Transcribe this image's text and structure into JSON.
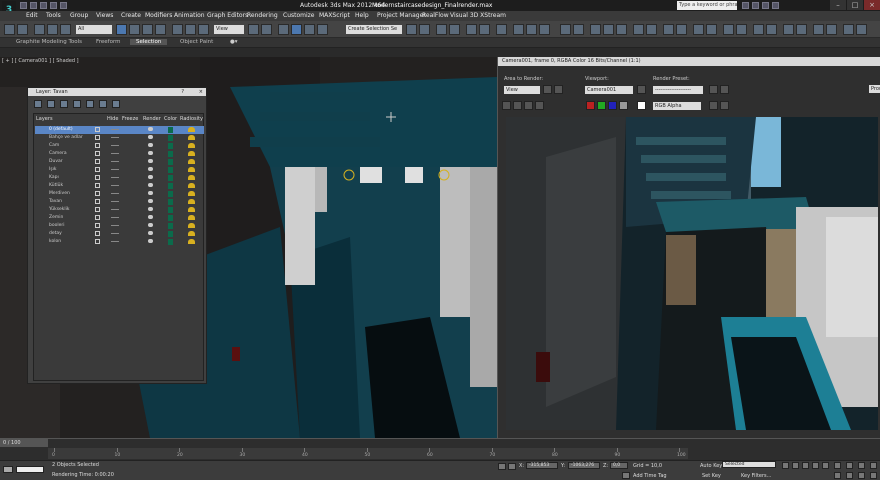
{
  "titlebar": {
    "app_title": "Autodesk 3ds Max  2012 x64",
    "file_name": "Modernstaircasedesign_Finalrender.max",
    "search_placeholder": "Type a keyword or phrase"
  },
  "menu": [
    "Edit",
    "Tools",
    "Group",
    "Views",
    "Create",
    "Modifiers",
    "Animation",
    "Graph Editors",
    "Rendering",
    "Customize",
    "MAXScript",
    "Help",
    "Project Manager",
    "RealFlow",
    "Visual 3D XStream"
  ],
  "toolbar": {
    "selection_filter": "All",
    "coordinate": "View",
    "selection_set": "Create Selection Se"
  },
  "ribbon": [
    "Graphite Modeling Tools",
    "Freeform",
    "Selection",
    "Object Paint"
  ],
  "viewport": {
    "label": "[ + ] [ Camera001 ] [ Shaded ]"
  },
  "layer_explorer": {
    "title": "Layer: Tavan",
    "columns": [
      "Layers",
      "Hide",
      "Freeze",
      "Render",
      "Color",
      "Radiosity"
    ],
    "rows": [
      {
        "name": "0 (default)"
      },
      {
        "name": "Bahçe ve adlar"
      },
      {
        "name": "Cam"
      },
      {
        "name": "Camera"
      },
      {
        "name": "Duvar"
      },
      {
        "name": "Işık"
      },
      {
        "name": "Kapı"
      },
      {
        "name": "Kütlük"
      },
      {
        "name": "Merdiven"
      },
      {
        "name": "Tavan"
      },
      {
        "name": "Yükseklik"
      },
      {
        "name": "Zemin"
      },
      {
        "name": "booleri"
      },
      {
        "name": "detay"
      },
      {
        "name": "kolon"
      }
    ]
  },
  "render_window": {
    "title": "Camera001, frame 0, RGBA Color 16 Bits/Channel (1:1)",
    "area_label": "Area to Render:",
    "area_value": "View",
    "viewport_label": "Viewport:",
    "viewport_value": "Camera001",
    "preset_label": "Render Preset:",
    "preset_value": "--------------------",
    "channel_value": "RGB Alpha",
    "production_button": "Produ"
  },
  "timeline": {
    "frame_readout": "0 / 100",
    "ticks": [
      "0",
      "10",
      "20",
      "30",
      "40",
      "50",
      "60",
      "70",
      "80",
      "90",
      "100"
    ]
  },
  "status": {
    "selected": "2 Objects Selected",
    "time": "Rendering Time: 0:00:20",
    "x_label": "X:",
    "x_value": "-315,853",
    "y_label": "Y:",
    "y_value": "-1063,276",
    "z_label": "Z:",
    "z_value": "0,0",
    "grid": "Grid = 10,0",
    "add_time_tag": "Add Time Tag",
    "auto_key": "Auto Key",
    "auto_key_mode": "Selected",
    "set_key": "Set Key",
    "key_filters": "Key Filters..."
  },
  "colors": {
    "accent_blue": "#5a86c6",
    "layer_color": "#0b6b4b",
    "scene_teal": "#0f3f4d",
    "sky": "#7ab7d8"
  }
}
